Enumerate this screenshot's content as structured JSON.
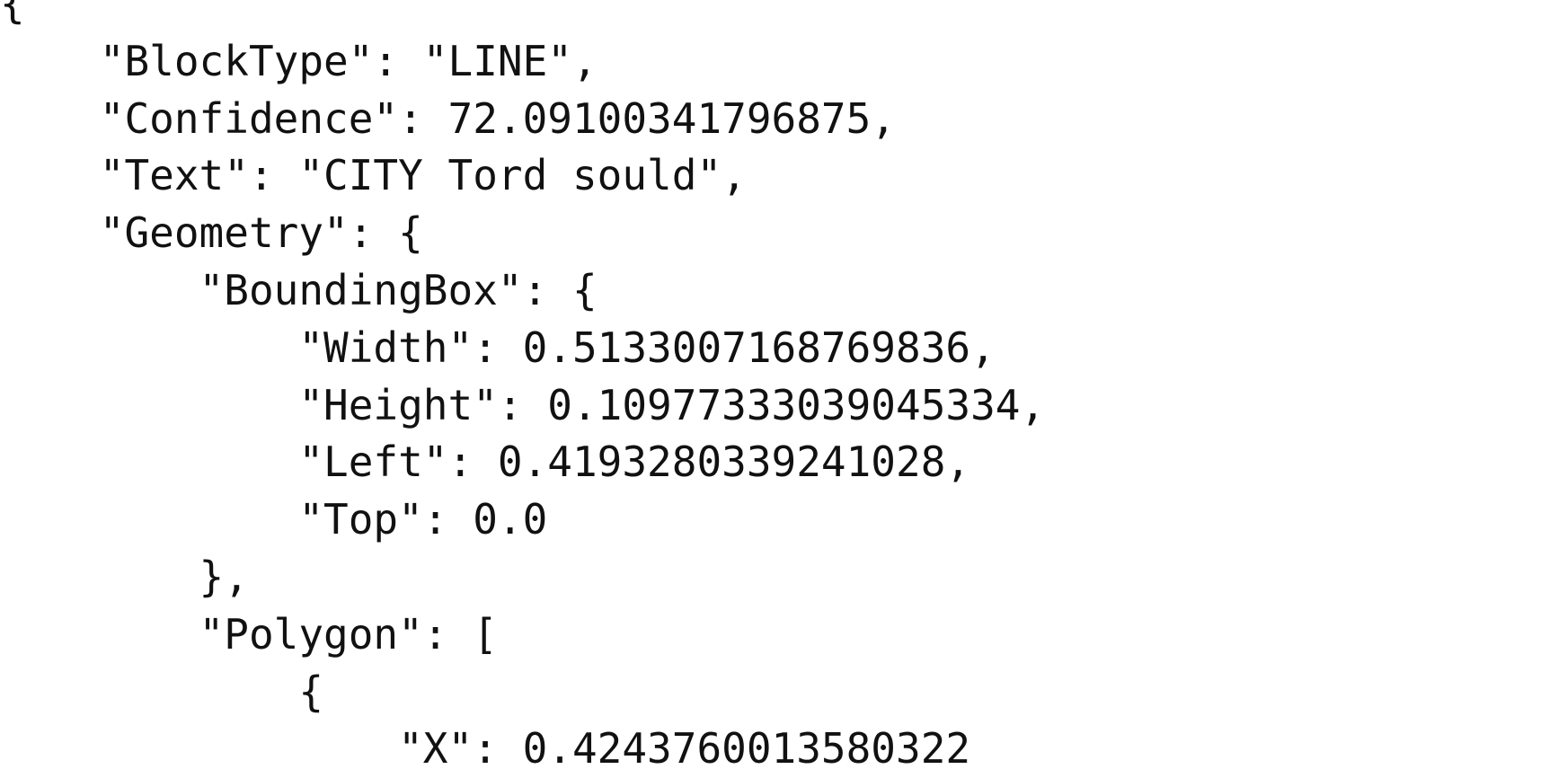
{
  "code_lines": [
    "{",
    "    \"BlockType\": \"LINE\",",
    "    \"Confidence\": 72.09100341796875,",
    "    \"Text\": \"CITY Tord sould\",",
    "    \"Geometry\": {",
    "        \"BoundingBox\": {",
    "            \"Width\": 0.5133007168769836,",
    "            \"Height\": 0.10977333039045334,",
    "            \"Left\": 0.4193280339241028,",
    "            \"Top\": 0.0",
    "        },",
    "        \"Polygon\": [",
    "            {",
    "                \"X\": 0.4243760013580322"
  ]
}
